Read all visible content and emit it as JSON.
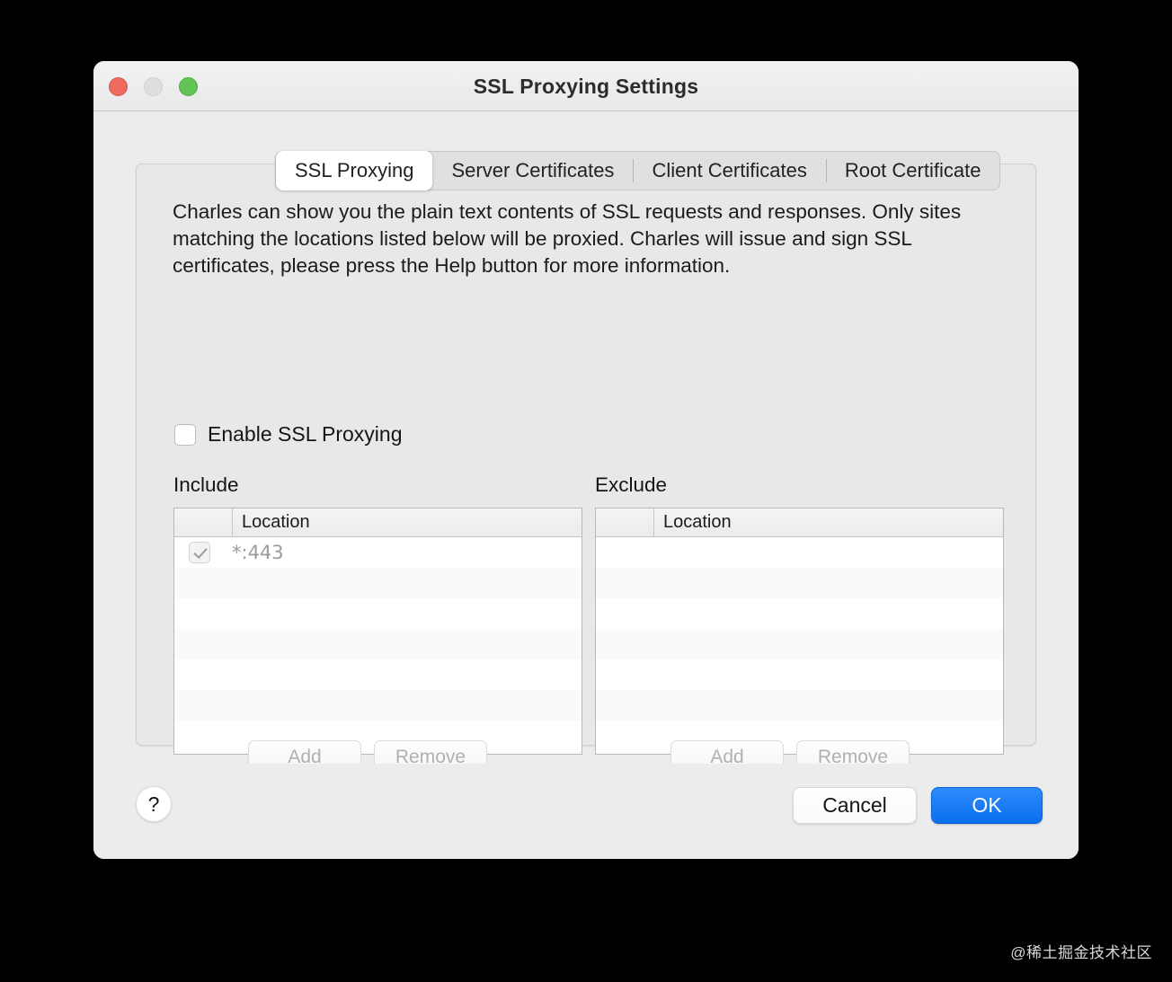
{
  "window": {
    "title": "SSL Proxying Settings",
    "traffic_lights": [
      {
        "name": "close",
        "color": "#ed6b5e"
      },
      {
        "name": "minimize",
        "color": "#dedede"
      },
      {
        "name": "zoom",
        "color": "#61c454"
      }
    ]
  },
  "tabs": [
    {
      "label": "SSL Proxying",
      "active": true
    },
    {
      "label": "Server Certificates",
      "active": false
    },
    {
      "label": "Client Certificates",
      "active": false
    },
    {
      "label": "Root Certificate",
      "active": false
    }
  ],
  "content": {
    "description": "Charles can show you the plain text contents of SSL requests and responses. Only sites matching the locations listed below will be proxied. Charles will issue and sign SSL certificates, please press the Help button for more information.",
    "enable_checkbox": {
      "label": "Enable SSL Proxying",
      "checked": false
    },
    "include": {
      "caption": "Include",
      "column_header": "Location",
      "rows": [
        {
          "checked": true,
          "location": "*:443",
          "enabled": false
        }
      ],
      "add_label": "Add",
      "remove_label": "Remove",
      "add_enabled": false,
      "remove_enabled": false
    },
    "exclude": {
      "caption": "Exclude",
      "column_header": "Location",
      "rows": [],
      "add_label": "Add",
      "remove_label": "Remove",
      "add_enabled": false,
      "remove_enabled": false
    }
  },
  "footer": {
    "help_label": "?",
    "cancel_label": "Cancel",
    "ok_label": "OK",
    "ok_color": "#1b82f5"
  },
  "watermark": "@稀土掘金技术社区"
}
